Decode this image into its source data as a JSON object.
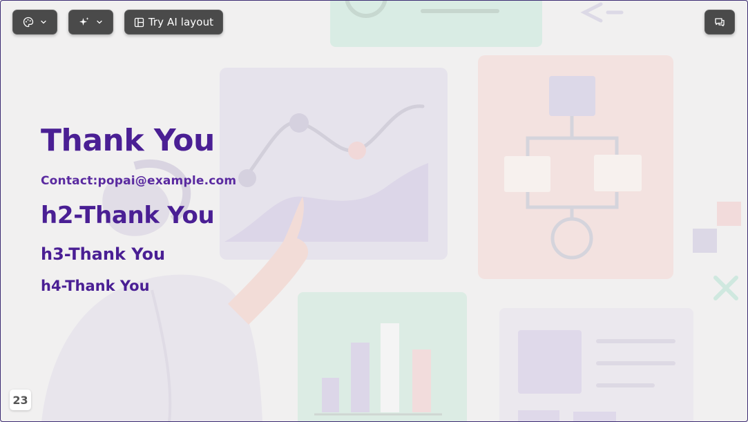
{
  "toolbar": {
    "theme_button": {
      "icon": "palette-icon",
      "dropdown_icon": "chevron-down-icon"
    },
    "ai_button": {
      "icon": "sparkle-icon",
      "dropdown_icon": "chevron-down-icon"
    },
    "layout_button": {
      "icon": "layout-icon",
      "label": "Try AI layout"
    },
    "comment_button": {
      "icon": "comment-icon"
    }
  },
  "slide": {
    "title": "Thank You",
    "contact": "Contact:popai@example.com",
    "h2": "h2-Thank You",
    "h3": "h3-Thank You",
    "h4": "h4-Thank You",
    "page_number": "23"
  },
  "colors": {
    "heading": "#4a1f94",
    "toolbar_bg": "#4a4a4a",
    "background": "#f1f0f0"
  }
}
